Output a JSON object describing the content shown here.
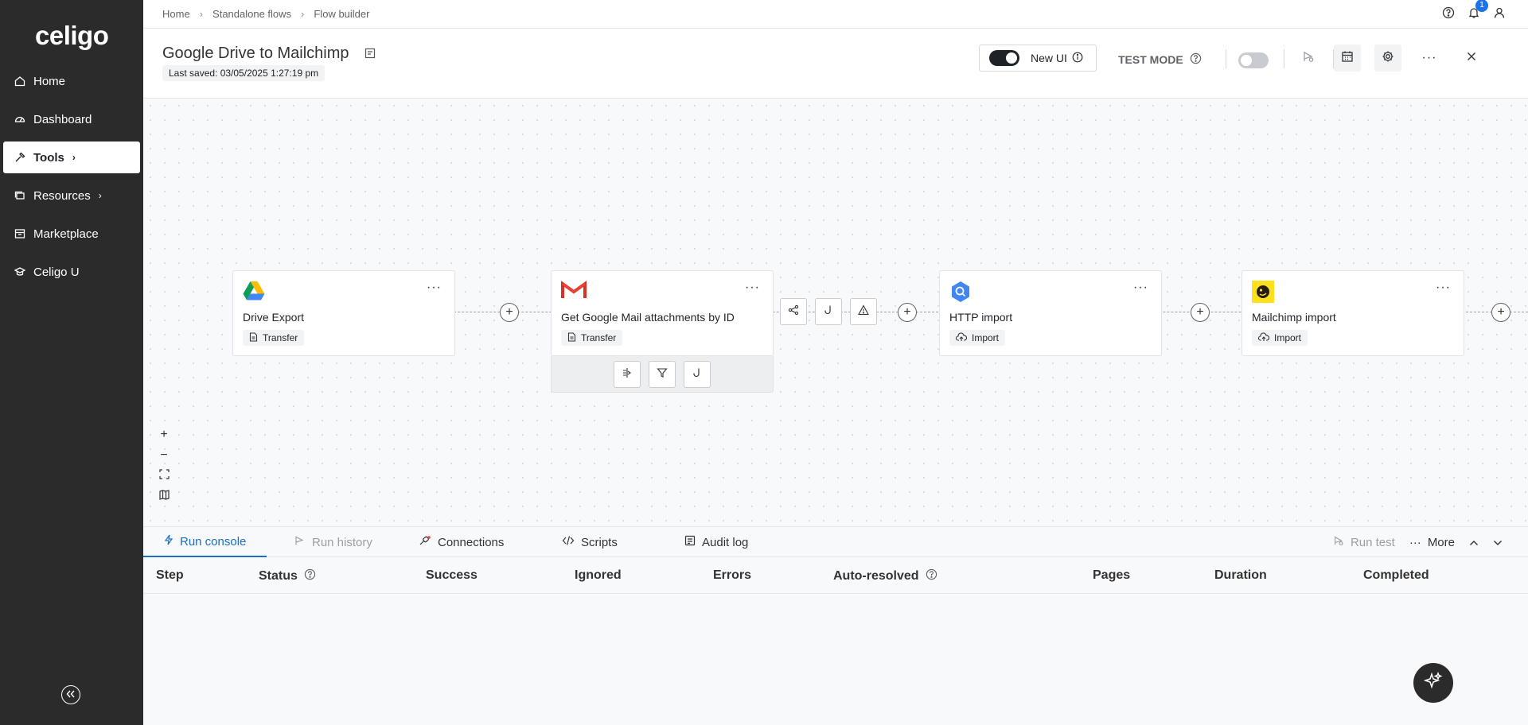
{
  "app": {
    "logo": "celigo"
  },
  "sidebar": {
    "items": [
      {
        "label": "Home",
        "icon": "home-icon"
      },
      {
        "label": "Dashboard",
        "icon": "dashboard-icon"
      },
      {
        "label": "Tools",
        "icon": "tools-icon",
        "active": true,
        "has_children": true
      },
      {
        "label": "Resources",
        "icon": "resources-icon",
        "has_children": true
      },
      {
        "label": "Marketplace",
        "icon": "marketplace-icon"
      },
      {
        "label": "Celigo U",
        "icon": "celigo-u-icon"
      }
    ]
  },
  "breadcrumb": [
    "Home",
    "Standalone flows",
    "Flow builder"
  ],
  "topbar": {
    "notification_count": "1"
  },
  "header": {
    "title": "Google Drive to Mailchimp",
    "last_saved": "Last saved: 03/05/2025 1:27:19 pm",
    "new_ui_label": "New UI",
    "test_mode_label": "TEST MODE"
  },
  "nodes": [
    {
      "name": "Drive Export",
      "tag": "Transfer",
      "logo": "google-drive-logo"
    },
    {
      "name": "Get Google Mail attachments by ID",
      "tag": "Transfer",
      "logo": "gmail-logo"
    },
    {
      "name": "HTTP import",
      "tag": "Import",
      "logo": "http-logo"
    },
    {
      "name": "Mailchimp import",
      "tag": "Import",
      "logo": "mailchimp-logo"
    }
  ],
  "console": {
    "tabs": [
      {
        "label": "Run console",
        "active": true
      },
      {
        "label": "Run history",
        "disabled": true
      },
      {
        "label": "Connections"
      },
      {
        "label": "Scripts"
      },
      {
        "label": "Audit log"
      }
    ],
    "run_test_label": "Run test",
    "more_label": "More",
    "columns": [
      "Step",
      "Status",
      "Success",
      "Ignored",
      "Errors",
      "Auto-resolved",
      "Pages",
      "Duration",
      "Completed"
    ]
  },
  "colors": {
    "sidebar_bg": "#2b2b2b",
    "accent": "#1a6fc2",
    "badge": "#1a73e8"
  }
}
